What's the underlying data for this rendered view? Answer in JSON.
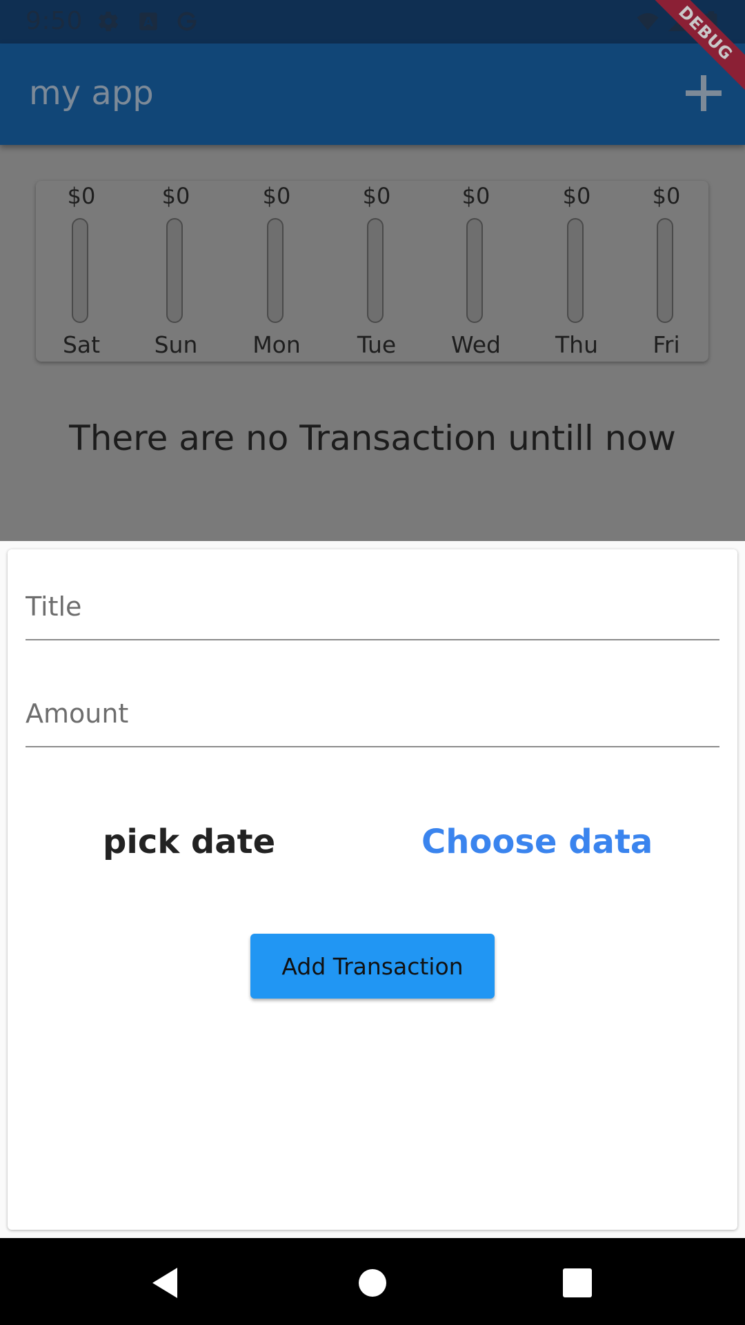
{
  "status_bar": {
    "time": "9:50",
    "icons": [
      "gear-icon",
      "keyboard-a-icon",
      "google-g-icon",
      "wifi-icon",
      "signal-icon",
      "battery-icon"
    ]
  },
  "app_bar": {
    "title": "my app",
    "action_icon": "add-icon"
  },
  "debug_banner": "DEBUG",
  "chart": {
    "bars": [
      {
        "day": "Sat",
        "amount": "$0",
        "fraction": 0
      },
      {
        "day": "Sun",
        "amount": "$0",
        "fraction": 0
      },
      {
        "day": "Mon",
        "amount": "$0",
        "fraction": 0
      },
      {
        "day": "Tue",
        "amount": "$0",
        "fraction": 0
      },
      {
        "day": "Wed",
        "amount": "$0",
        "fraction": 0
      },
      {
        "day": "Thu",
        "amount": "$0",
        "fraction": 0
      },
      {
        "day": "Fri",
        "amount": "$0",
        "fraction": 0
      }
    ]
  },
  "empty_message": "There are no Transaction untill now",
  "form": {
    "title_placeholder": "Title",
    "amount_placeholder": "Amount",
    "date_label": "pick date",
    "choose_label": "Choose data",
    "submit_label": "Add Transaction"
  },
  "nav": [
    "back-icon",
    "home-icon",
    "recents-icon"
  ],
  "colors": {
    "app_bar": "#114677",
    "accent": "#2196f3",
    "link": "#3a84ee"
  }
}
